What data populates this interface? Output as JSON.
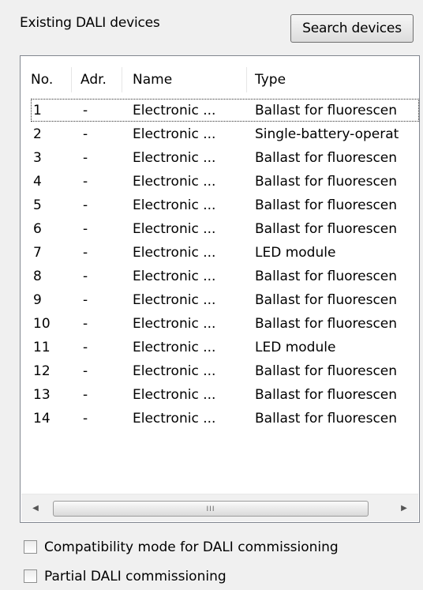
{
  "group": {
    "title": "Existing DALI devices",
    "search_button_label": "Search devices"
  },
  "table": {
    "columns": [
      "No.",
      "Adr.",
      "Name",
      "Type"
    ],
    "focused_row": 0,
    "rows": [
      {
        "no": "1",
        "adr": "-",
        "name": "Electronic ...",
        "type": "Ballast for fluorescen"
      },
      {
        "no": "2",
        "adr": "-",
        "name": "Electronic ...",
        "type": "Single-battery-operat"
      },
      {
        "no": "3",
        "adr": "-",
        "name": "Electronic ...",
        "type": "Ballast for fluorescen"
      },
      {
        "no": "4",
        "adr": "-",
        "name": "Electronic ...",
        "type": "Ballast for fluorescen"
      },
      {
        "no": "5",
        "adr": "-",
        "name": "Electronic ...",
        "type": "Ballast for fluorescen"
      },
      {
        "no": "6",
        "adr": "-",
        "name": "Electronic ...",
        "type": "Ballast for fluorescen"
      },
      {
        "no": "7",
        "adr": "-",
        "name": "Electronic ...",
        "type": "LED module"
      },
      {
        "no": "8",
        "adr": "-",
        "name": "Electronic ...",
        "type": "Ballast for fluorescen"
      },
      {
        "no": "9",
        "adr": "-",
        "name": "Electronic ...",
        "type": "Ballast for fluorescen"
      },
      {
        "no": "10",
        "adr": "-",
        "name": "Electronic ...",
        "type": "Ballast for fluorescen"
      },
      {
        "no": "11",
        "adr": "-",
        "name": "Electronic ...",
        "type": "LED module"
      },
      {
        "no": "12",
        "adr": "-",
        "name": "Electronic ...",
        "type": "Ballast for fluorescen"
      },
      {
        "no": "13",
        "adr": "-",
        "name": "Electronic ...",
        "type": "Ballast for fluorescen"
      },
      {
        "no": "14",
        "adr": "-",
        "name": "Electronic ...",
        "type": "Ballast for fluorescen"
      }
    ]
  },
  "scrollbar": {
    "left_arrow_icon": "chevron-left-icon",
    "right_arrow_icon": "chevron-right-icon",
    "grip_glyph": "III"
  },
  "options": {
    "compatibility_mode": {
      "label": "Compatibility mode for DALI commissioning",
      "checked": false
    },
    "partial_commissioning": {
      "label": "Partial DALI commissioning",
      "checked": false
    }
  }
}
